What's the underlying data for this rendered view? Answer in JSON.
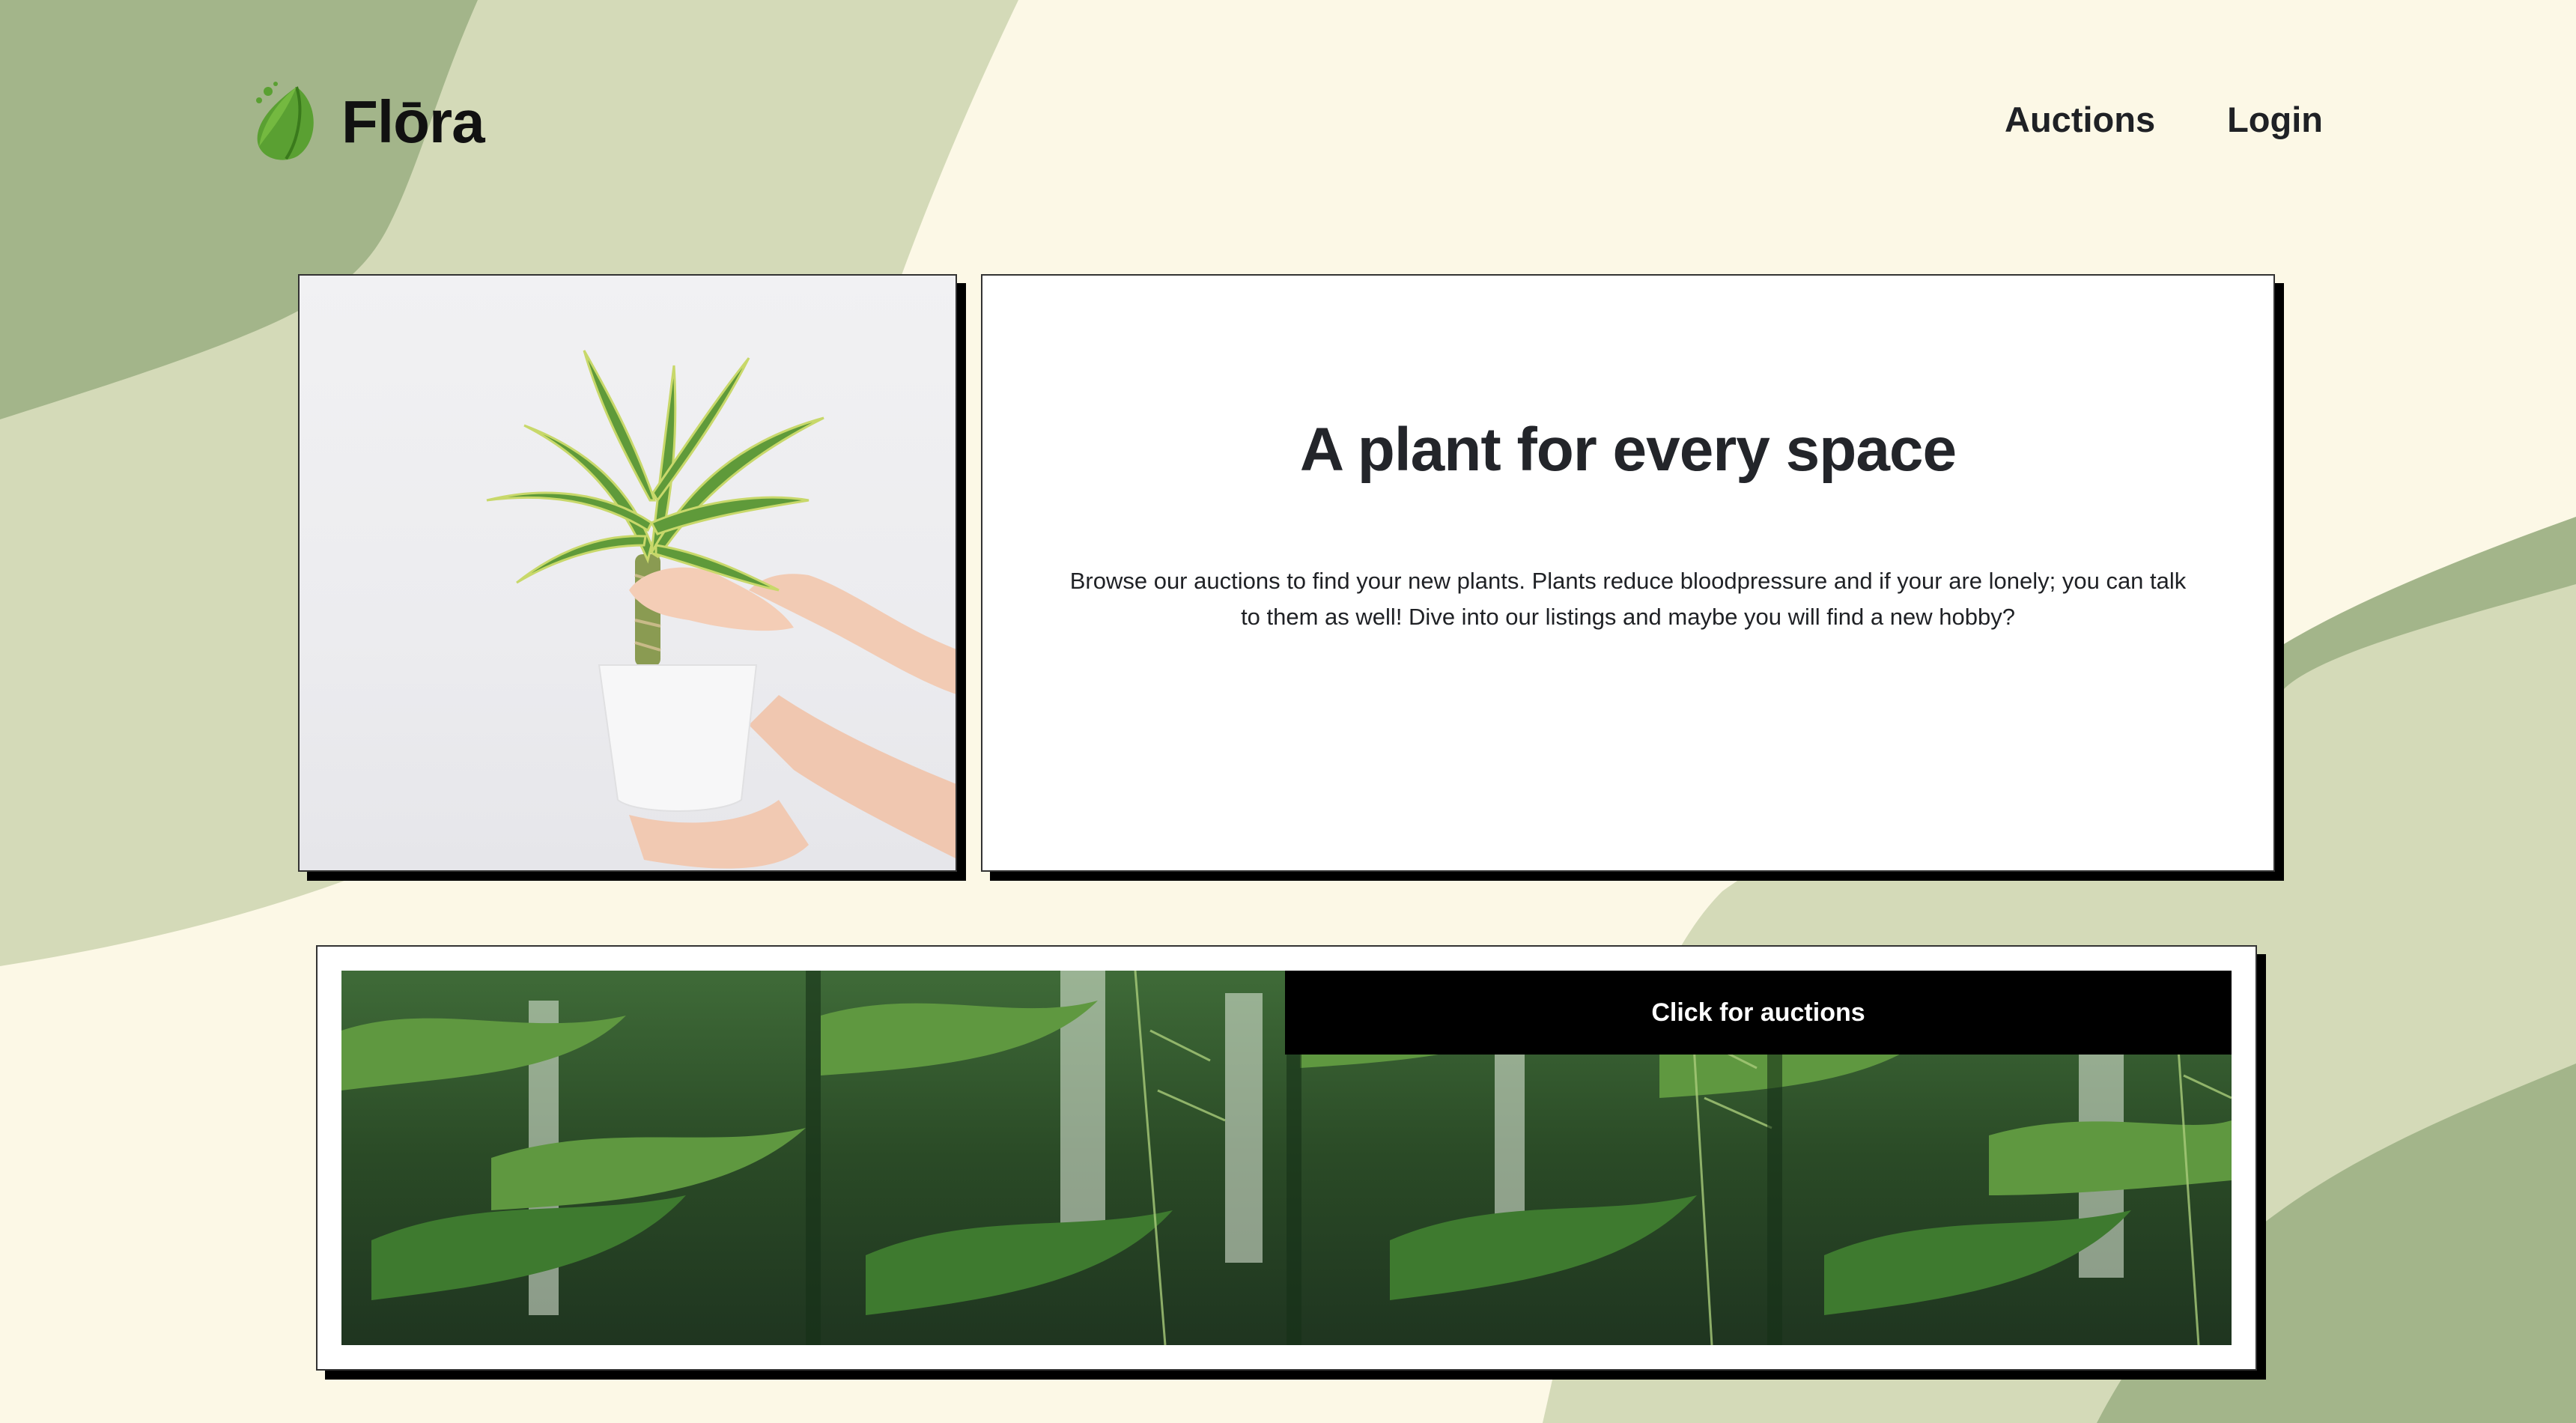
{
  "header": {
    "brand": "Flōra",
    "nav": [
      {
        "label": "Auctions"
      },
      {
        "label": "Login"
      }
    ]
  },
  "hero": {
    "title": "A plant for every space",
    "body": "Browse our auctions to find your new plants. Plants reduce bloodpressure and if your are lonely; you can talk to them as well! Dive into our listings and maybe you will find a new hobby?"
  },
  "banner": {
    "button_label": "Click for auctions"
  },
  "colors": {
    "background": "#fcf8e6",
    "wave_light": "#d4dab8",
    "wave_dark": "#a3b58a",
    "card_shadow": "#000000",
    "button_bg": "#000000",
    "leaf": "#5aa032"
  },
  "icons": {
    "logo": "leaf-icon"
  }
}
